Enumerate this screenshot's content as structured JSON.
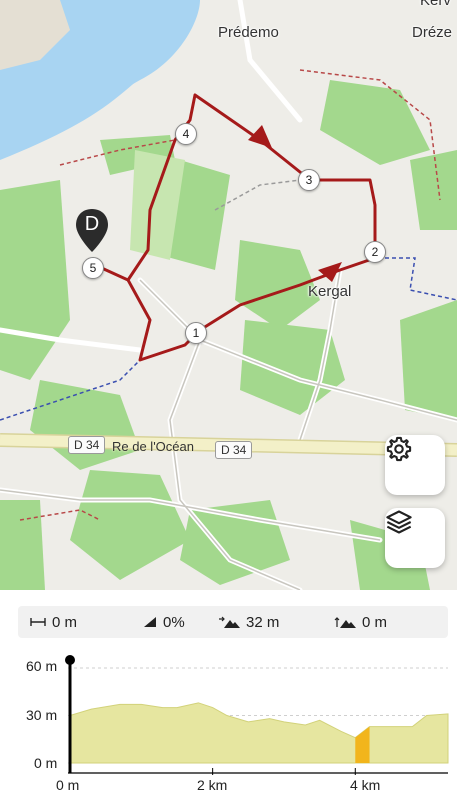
{
  "map": {
    "places": {
      "predemo": "Prédemo",
      "dreze": "Dréze",
      "kergal": "Kergal",
      "kerv": "Kerv"
    },
    "road_label": "Re de l'Océan",
    "road_shields": [
      "D 34",
      "D 34"
    ],
    "start_marker": "D",
    "waypoints": [
      "1",
      "2",
      "3",
      "4",
      "5"
    ],
    "route_color": "#a51a1a"
  },
  "buttons": {
    "settings": "gear-icon",
    "layers": "layers-icon"
  },
  "stats": {
    "distance": "0 m",
    "grade": "0%",
    "ascent": "32 m",
    "descent": "0 m"
  },
  "chart_data": {
    "type": "area",
    "title": "",
    "xlabel": "",
    "ylabel": "",
    "x_ticks": [
      "0 m",
      "2 km",
      "4 km"
    ],
    "y_ticks": [
      "60 m",
      "30 m",
      "0 m"
    ],
    "ylim": [
      0,
      60
    ],
    "xlim": [
      0,
      5.3
    ],
    "x": [
      0,
      0.3,
      0.7,
      1.0,
      1.3,
      1.5,
      1.8,
      2.0,
      2.2,
      2.5,
      2.8,
      3.0,
      3.3,
      3.5,
      3.8,
      4.0,
      4.2,
      4.5,
      4.8,
      5.0,
      5.3
    ],
    "series": [
      {
        "values": [
          30,
          34,
          37,
          37,
          35,
          35,
          38,
          35,
          30,
          26,
          28,
          26,
          24,
          27,
          20,
          16,
          23,
          23,
          23,
          30,
          31
        ]
      }
    ],
    "fill_color": "#e6e6a0",
    "steep_section_color": "#f2b51c",
    "steep_section": [
      4.0,
      4.2
    ]
  }
}
